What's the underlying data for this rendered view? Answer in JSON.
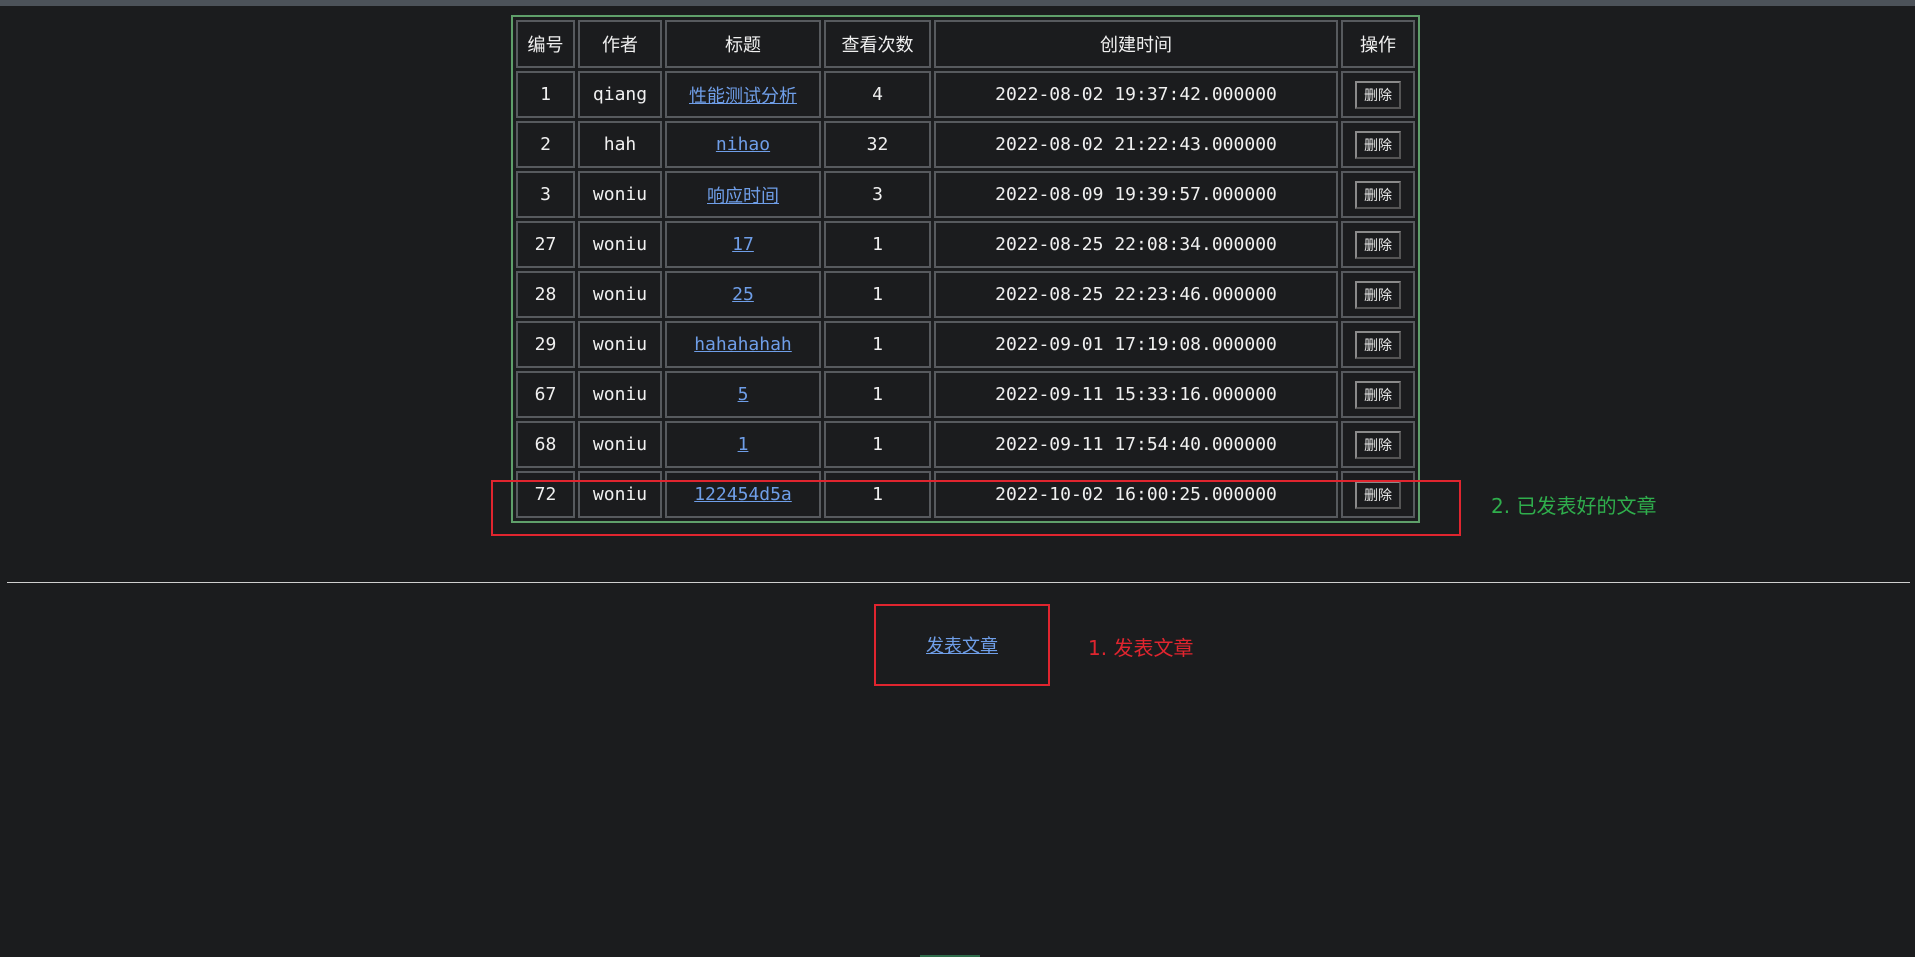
{
  "table": {
    "headers": [
      "编号",
      "作者",
      "标题",
      "查看次数",
      "创建时间",
      "操作"
    ],
    "rows": [
      {
        "id": "1",
        "author": "qiang",
        "title": "性能测试分析",
        "views": "4",
        "created": "2022-08-02 19:37:42.000000",
        "action": "删除"
      },
      {
        "id": "2",
        "author": "hah",
        "title": "nihao",
        "views": "32",
        "created": "2022-08-02 21:22:43.000000",
        "action": "删除"
      },
      {
        "id": "3",
        "author": "woniu",
        "title": "响应时间",
        "views": "3",
        "created": "2022-08-09 19:39:57.000000",
        "action": "删除"
      },
      {
        "id": "27",
        "author": "woniu",
        "title": "17",
        "views": "1",
        "created": "2022-08-25 22:08:34.000000",
        "action": "删除"
      },
      {
        "id": "28",
        "author": "woniu",
        "title": "25",
        "views": "1",
        "created": "2022-08-25 22:23:46.000000",
        "action": "删除"
      },
      {
        "id": "29",
        "author": "woniu",
        "title": "hahahahah",
        "views": "1",
        "created": "2022-09-01 17:19:08.000000",
        "action": "删除"
      },
      {
        "id": "67",
        "author": "woniu",
        "title": "5",
        "views": "1",
        "created": "2022-09-11 15:33:16.000000",
        "action": "删除"
      },
      {
        "id": "68",
        "author": "woniu",
        "title": "1",
        "views": "1",
        "created": "2022-09-11 17:54:40.000000",
        "action": "删除"
      },
      {
        "id": "72",
        "author": "woniu",
        "title": "122454d5a",
        "views": "1",
        "created": "2022-10-02 16:00:25.000000",
        "action": "删除"
      }
    ]
  },
  "annotations": {
    "published_note": "2. 已发表好的文章",
    "post_note": "1. 发表文章"
  },
  "post_link_label": "发表文章",
  "colors": {
    "background": "#1b1c1e",
    "link": "#6f9ee8",
    "table_border": "#5f9f6a",
    "highlight": "#e0252f",
    "note_green": "#2fae4c"
  }
}
